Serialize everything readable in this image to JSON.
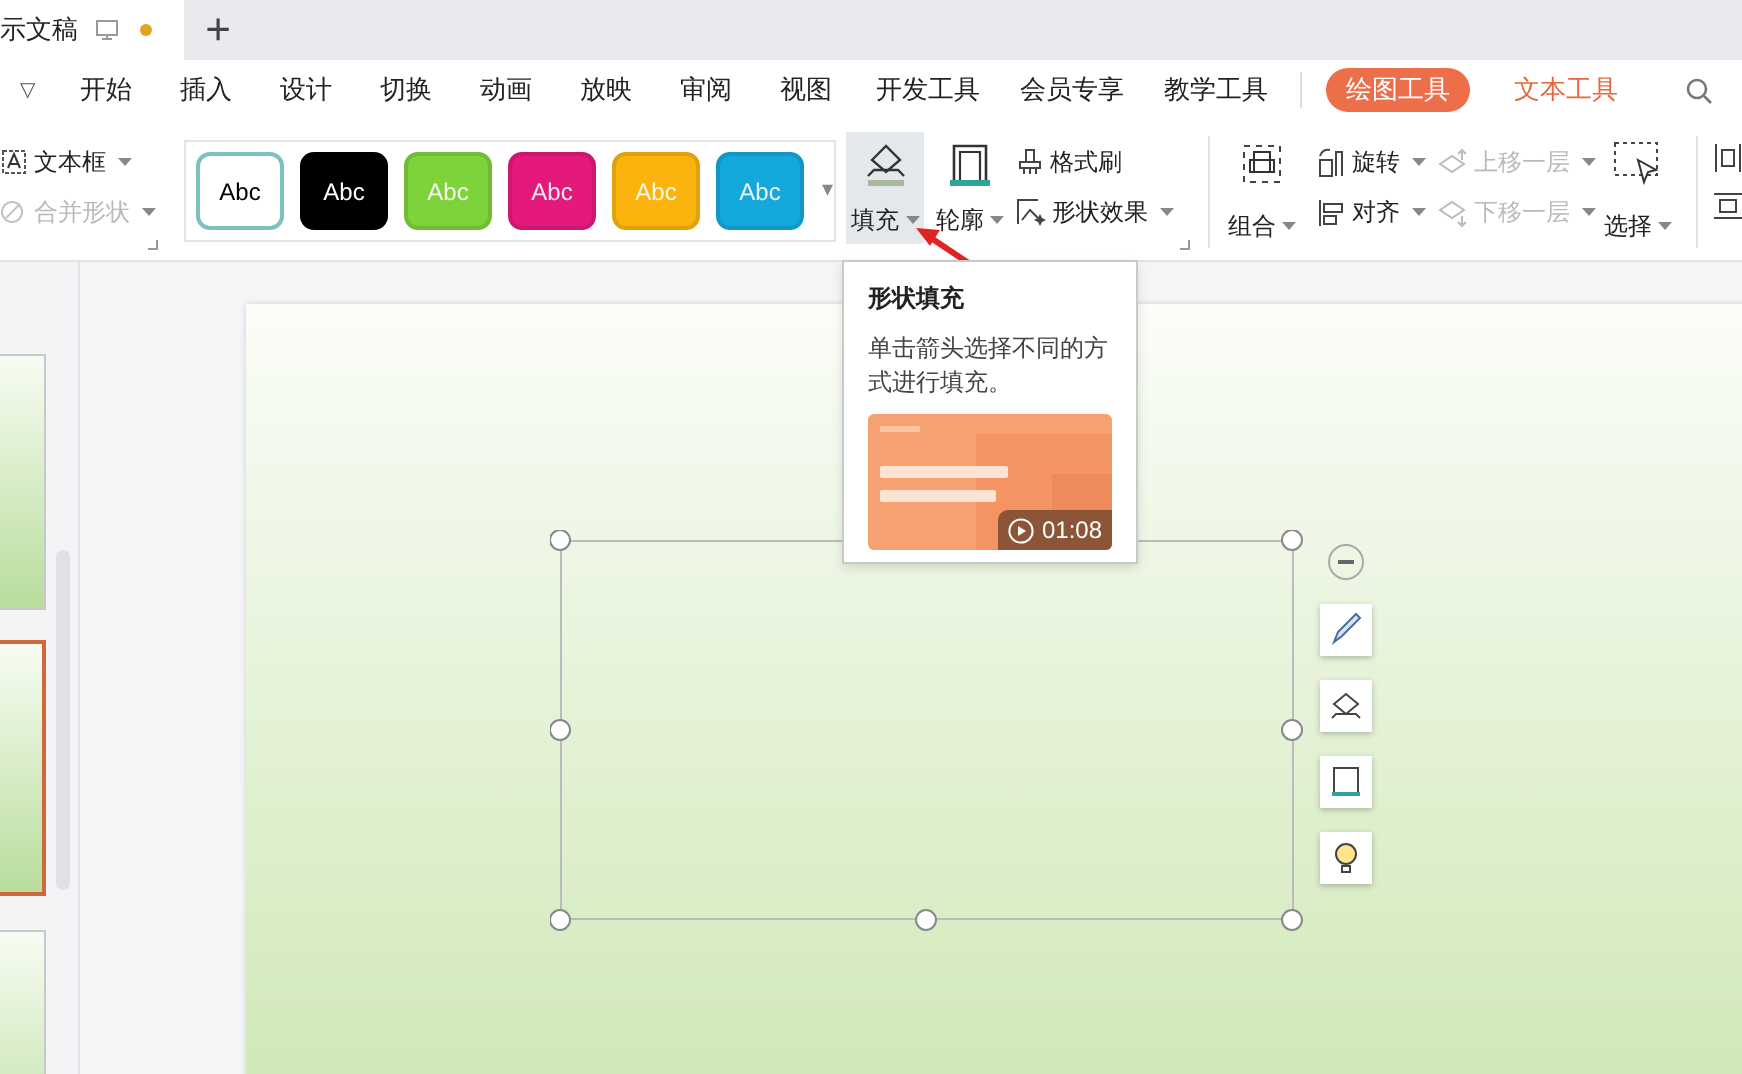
{
  "document_tabs": [
    {
      "label": "示文稿",
      "selected": true,
      "modified": true
    }
  ],
  "new_tab": "+",
  "menu": {
    "collapse": "▽",
    "items": [
      {
        "label": "开始",
        "kind": "plain",
        "selected": false
      },
      {
        "label": "插入",
        "kind": "plain",
        "selected": false
      },
      {
        "label": "设计",
        "kind": "plain",
        "selected": false
      },
      {
        "label": "切换",
        "kind": "plain",
        "selected": false
      },
      {
        "label": "动画",
        "kind": "plain",
        "selected": false
      },
      {
        "label": "放映",
        "kind": "plain",
        "selected": false
      },
      {
        "label": "审阅",
        "kind": "plain",
        "selected": false
      },
      {
        "label": "视图",
        "kind": "plain",
        "selected": false
      },
      {
        "label": "开发工具",
        "kind": "plain",
        "selected": false
      },
      {
        "label": "会员专享",
        "kind": "plain",
        "selected": false
      },
      {
        "label": "教学工具",
        "kind": "plain",
        "selected": false
      },
      {
        "label": "绘图工具",
        "kind": "context",
        "selected": true
      },
      {
        "label": "文本工具",
        "kind": "context",
        "selected": false
      }
    ]
  },
  "ribbon": {
    "text_box": {
      "label": "文本框",
      "disabled": false
    },
    "merge_shapes": {
      "label": "合并形状",
      "disabled": true
    },
    "style_swatches": [
      {
        "label": "Abc",
        "color": "#ffffff",
        "selected": true
      },
      {
        "label": "Abc",
        "color": "#000000",
        "selected": false
      },
      {
        "label": "Abc",
        "color": "#7ed23a",
        "selected": false
      },
      {
        "label": "Abc",
        "color": "#e4197c",
        "selected": false
      },
      {
        "label": "Abc",
        "color": "#fbb40d",
        "selected": false
      },
      {
        "label": "Abc",
        "color": "#14a8dc",
        "selected": false
      }
    ],
    "gallery_more": "▾",
    "fill": {
      "label": "填充",
      "hovered": true
    },
    "outline": {
      "label": "轮廓",
      "hovered": false
    },
    "format_painter": {
      "label": "格式刷",
      "disabled": false
    },
    "shape_effects": {
      "label": "形状效果",
      "disabled": false
    },
    "group": {
      "label": "组合",
      "disabled": false
    },
    "rotate": {
      "label": "旋转",
      "disabled": false
    },
    "align": {
      "label": "对齐",
      "disabled": false
    },
    "bring_forward": {
      "label": "上移一层",
      "disabled": true
    },
    "send_backward": {
      "label": "下移一层",
      "disabled": true
    },
    "select": {
      "label": "选择",
      "disabled": false
    }
  },
  "tooltip": {
    "title": "形状填充",
    "text": "单击箭头选择不同的方式进行填充。",
    "video": {
      "kind": "picture",
      "duration": "01:08"
    }
  },
  "slides": [
    {
      "selected": false
    },
    {
      "selected": true
    },
    {
      "selected": false
    }
  ]
}
